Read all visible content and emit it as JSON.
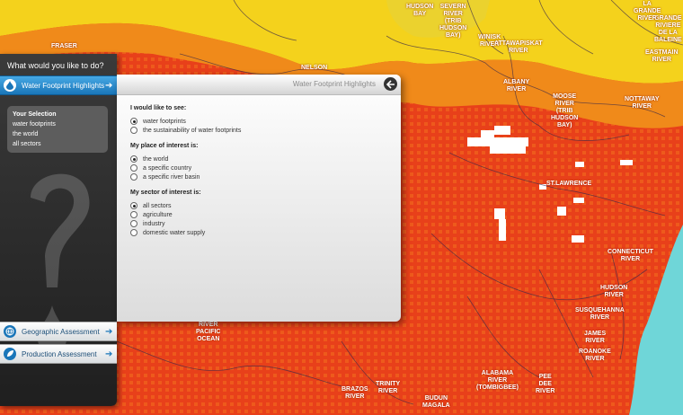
{
  "map": {
    "labels": [
      {
        "text": "HUDSON\nBAY",
        "key": "hudson"
      },
      {
        "text": "SEVERN\nRIVER\n(TRIB\nHUDSON\nBAY)",
        "key": "severn"
      },
      {
        "text": "WINISK\nRIVER",
        "key": "winisk"
      },
      {
        "text": "ATTAWAPISKAT\nRIVER",
        "key": "attawapiskat"
      },
      {
        "text": "ALBANY\nRIVER",
        "key": "albany"
      },
      {
        "text": "MOOSE\nRIVER\n(TRIB\nHUDSON\nBAY)",
        "key": "moose"
      },
      {
        "text": "NOTTAWAY\nRIVER",
        "key": "nottaway"
      },
      {
        "text": "GRANDE\nRIVIERE\nDE LA\nBALEINE",
        "key": "grande"
      },
      {
        "text": "EASTMAIN\nRIVER",
        "key": "eastmain"
      },
      {
        "text": "LA\nGRANDE\nRIVER",
        "key": "lagrande"
      },
      {
        "text": "NELSON",
        "key": "nelson"
      },
      {
        "text": "FRASER",
        "key": "fraser"
      },
      {
        "text": "ST.LAWRENCE",
        "key": "stlawrence"
      },
      {
        "text": "CONNECTICUT\nRIVER",
        "key": "connecticut"
      },
      {
        "text": "HUDSON\nRIVER",
        "key": "hudsonriver"
      },
      {
        "text": "SUSQUEHANNA\nRIVER",
        "key": "susquehanna"
      },
      {
        "text": "JAMES\nRIVER",
        "key": "james"
      },
      {
        "text": "ROANOKE\nRIVER",
        "key": "roanoke"
      },
      {
        "text": "PEE\nDEE\nRIVER",
        "key": "peedee"
      },
      {
        "text": "ALABAMA\nRIVER\n(TOMBIGBEE)",
        "key": "alabama"
      },
      {
        "text": "TRINITY\nRIVER",
        "key": "trinity"
      },
      {
        "text": "BRAZOS\nRIVER",
        "key": "brazos"
      },
      {
        "text": "RIVER\nPACIFIC\nOCEAN",
        "key": "pacific"
      },
      {
        "text": "BUDUN\nMAGALA",
        "key": "budun"
      }
    ]
  },
  "sidebar": {
    "title": "What would you like to do?",
    "nav": [
      {
        "label": "Water Footprint Highlights",
        "icon": "water-drop-icon"
      },
      {
        "label": "Geographic Assessment",
        "icon": "globe-icon"
      },
      {
        "label": "Production Assessment",
        "icon": "leaf-icon"
      }
    ],
    "selection": {
      "header": "Your Selection",
      "items": [
        "water footprints",
        "the world",
        "all sectors"
      ]
    }
  },
  "panel": {
    "title": "Water Footprint Highlights",
    "questions": [
      {
        "label": "I would like to see:",
        "options": [
          "water footprints",
          "the sustainability of water footprints"
        ],
        "selected": 0
      },
      {
        "label": "My place of interest is:",
        "options": [
          "the world",
          "a specific country",
          "a specific river basin"
        ],
        "selected": 0
      },
      {
        "label": "My sector of interest is:",
        "options": [
          "all sectors",
          "agriculture",
          "industry",
          "domestic water supply"
        ],
        "selected": 0
      }
    ]
  },
  "colors": {
    "accent": "#1a76b9",
    "map_high": "#e8401a",
    "map_mid": "#f07a1a",
    "map_low": "#f4e01a",
    "ocean": "#6fd6d8"
  }
}
